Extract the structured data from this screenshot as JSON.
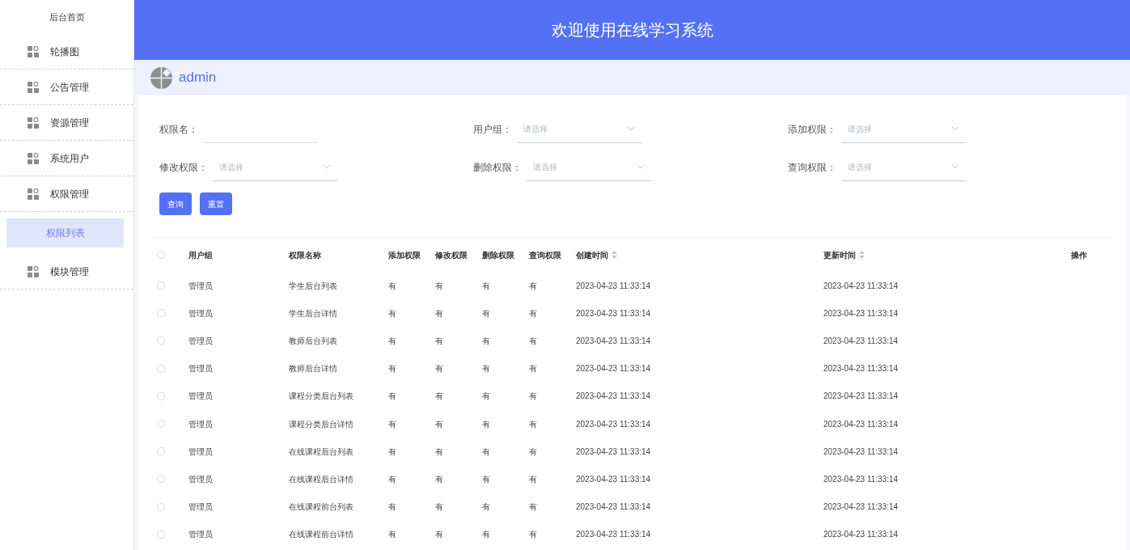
{
  "sidebar": {
    "home": "后台首页",
    "items": [
      {
        "label": "轮播图",
        "kind": "menu",
        "selected": false
      },
      {
        "label": "公告管理",
        "kind": "menu",
        "selected": false
      },
      {
        "label": "资源管理",
        "kind": "menu",
        "selected": false
      },
      {
        "label": "系统用户",
        "kind": "menu",
        "selected": false
      },
      {
        "label": "权限管理",
        "kind": "menu",
        "selected": false
      },
      {
        "label": "权限列表",
        "kind": "sub",
        "selected": true
      },
      {
        "label": "模块管理",
        "kind": "menu",
        "selected": false
      }
    ]
  },
  "header": {
    "title": "欢迎使用在线学习系统"
  },
  "user": {
    "name": "admin"
  },
  "filters": [
    {
      "label": "权限名：",
      "kind": "text"
    },
    {
      "label": "用户组：",
      "kind": "select",
      "placeholder": "请选择"
    },
    {
      "label": "添加权限：",
      "kind": "select",
      "placeholder": "请选择"
    },
    {
      "label": "修改权限：",
      "kind": "select",
      "placeholder": "请选择"
    },
    {
      "label": "删除权限：",
      "kind": "select",
      "placeholder": "请选择"
    },
    {
      "label": "查询权限：",
      "kind": "select",
      "placeholder": "请选择"
    }
  ],
  "buttons": [
    "查询",
    "重置"
  ],
  "table": {
    "all_checked": false,
    "columns": [
      {
        "label": "用户组",
        "kind": "plain"
      },
      {
        "label": "权限名称",
        "kind": "plain"
      },
      {
        "label": "添加权限",
        "kind": "plain"
      },
      {
        "label": "修改权限",
        "kind": "plain"
      },
      {
        "label": "删除权限",
        "kind": "plain"
      },
      {
        "label": "查询权限",
        "kind": "plain"
      },
      {
        "label": "创建时间",
        "kind": "sort"
      },
      {
        "label": "更新时间",
        "kind": "sort"
      },
      {
        "label": "操作",
        "kind": "plain"
      }
    ],
    "rows": [
      {
        "checked": false,
        "cells": [
          "管理员",
          "学生后台列表",
          "有",
          "有",
          "有",
          "有",
          "2023-04-23 11:33:14",
          "2023-04-23 11:33:14"
        ]
      },
      {
        "checked": false,
        "cells": [
          "管理员",
          "学生后台详情",
          "有",
          "有",
          "有",
          "有",
          "2023-04-23 11:33:14",
          "2023-04-23 11:33:14"
        ]
      },
      {
        "checked": false,
        "cells": [
          "管理员",
          "教师后台列表",
          "有",
          "有",
          "有",
          "有",
          "2023-04-23 11:33:14",
          "2023-04-23 11:33:14"
        ]
      },
      {
        "checked": false,
        "cells": [
          "管理员",
          "教师后台详情",
          "有",
          "有",
          "有",
          "有",
          "2023-04-23 11:33:14",
          "2023-04-23 11:33:14"
        ]
      },
      {
        "checked": false,
        "cells": [
          "管理员",
          "课程分类后台列表",
          "有",
          "有",
          "有",
          "有",
          "2023-04-23 11:33:14",
          "2023-04-23 11:33:14"
        ]
      },
      {
        "checked": false,
        "cells": [
          "管理员",
          "课程分类后台详情",
          "有",
          "有",
          "有",
          "有",
          "2023-04-23 11:33:14",
          "2023-04-23 11:33:14"
        ]
      },
      {
        "checked": false,
        "cells": [
          "管理员",
          "在线课程后台列表",
          "有",
          "有",
          "有",
          "有",
          "2023-04-23 11:33:14",
          "2023-04-23 11:33:14"
        ]
      },
      {
        "checked": false,
        "cells": [
          "管理员",
          "在线课程后台详情",
          "有",
          "有",
          "有",
          "有",
          "2023-04-23 11:33:14",
          "2023-04-23 11:33:14"
        ]
      },
      {
        "checked": false,
        "cells": [
          "管理员",
          "在线课程前台列表",
          "有",
          "有",
          "有",
          "有",
          "2023-04-23 11:33:14",
          "2023-04-23 11:33:14"
        ]
      },
      {
        "checked": false,
        "cells": [
          "管理员",
          "在线课程前台详情",
          "有",
          "有",
          "有",
          "有",
          "2023-04-23 11:33:14",
          "2023-04-23 11:33:14"
        ]
      }
    ]
  }
}
